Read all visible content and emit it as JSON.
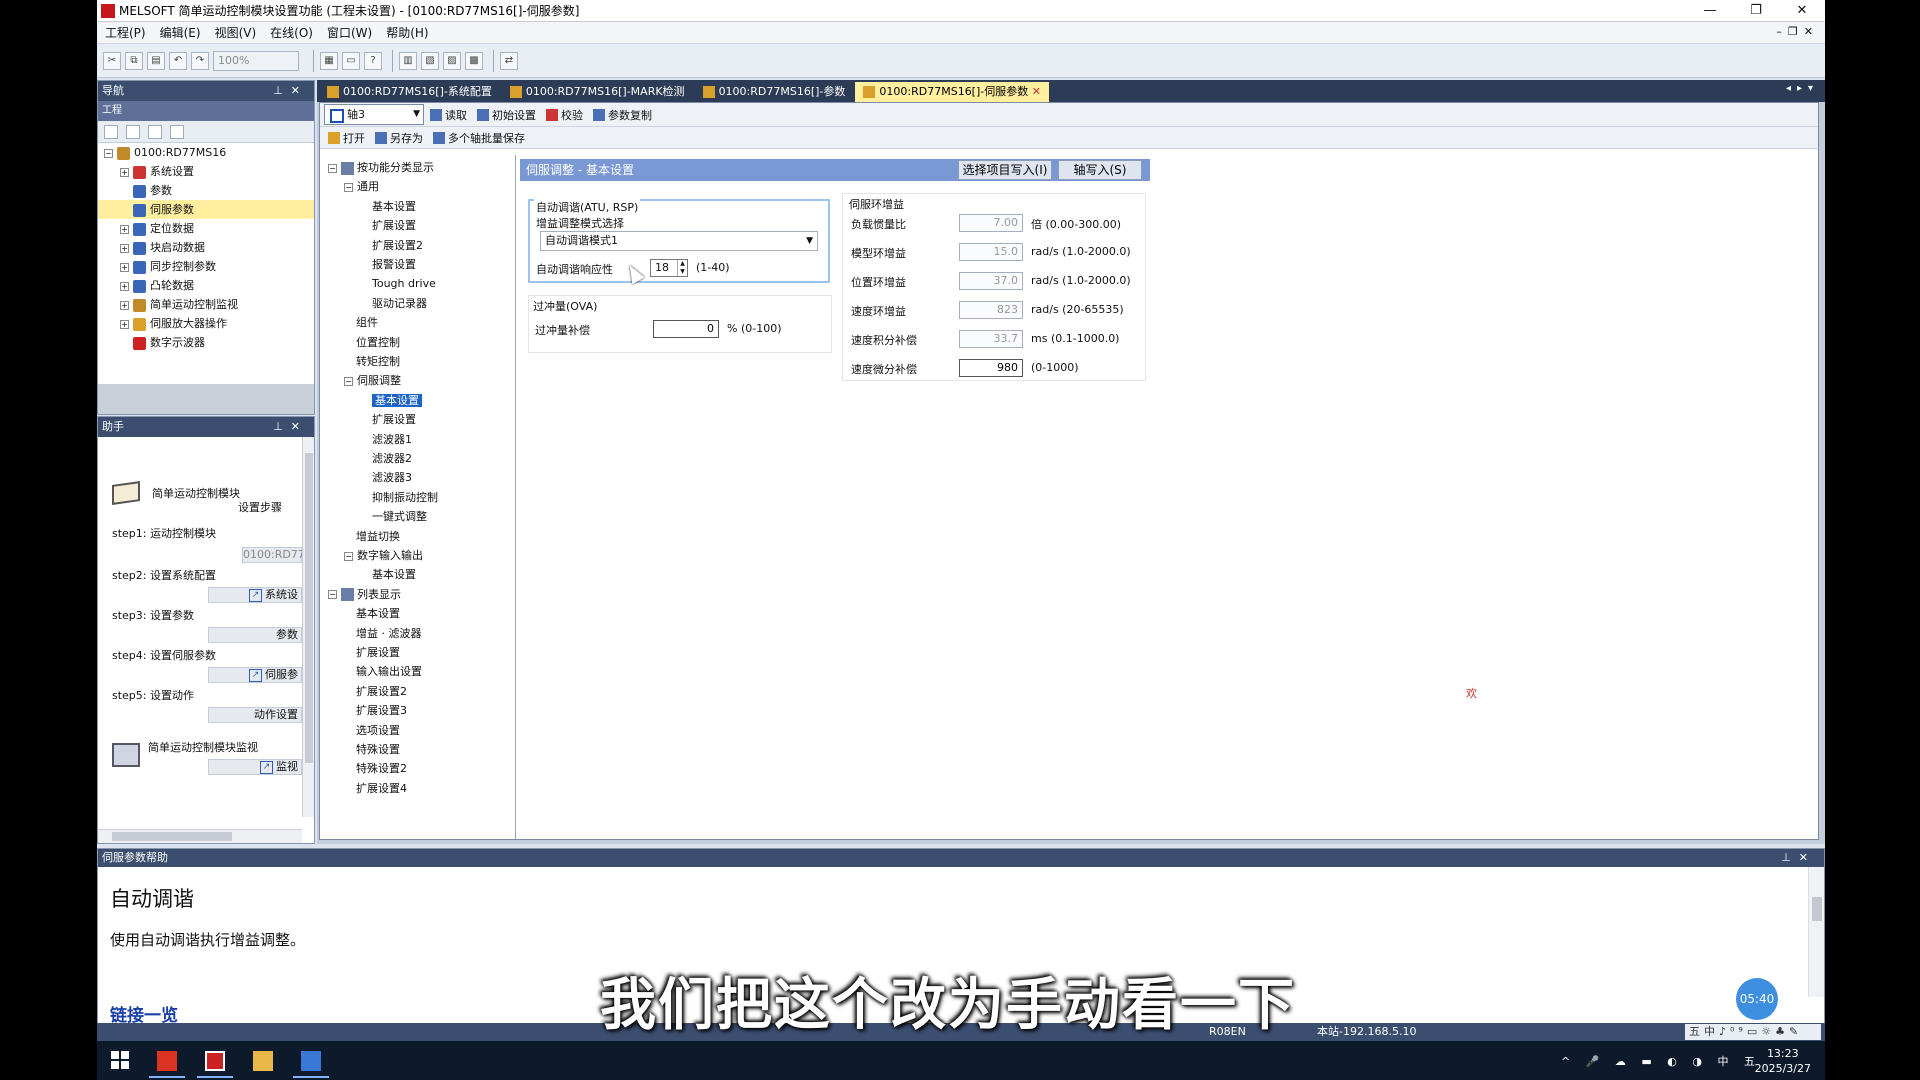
{
  "window": {
    "title": "MELSOFT 简单运动控制模块设置功能 (工程未设置) - [0100:RD77MS16[]-伺服参数]",
    "controls": [
      "—",
      "❐",
      "✕"
    ]
  },
  "menu": {
    "items": [
      "工程(P)",
      "编辑(E)",
      "视图(V)",
      "在线(O)",
      "窗口(W)",
      "帮助(H)"
    ],
    "zoom": "100%"
  },
  "navigation": {
    "header": "导航",
    "subheader": "工程",
    "tree": [
      {
        "label": "0100:RD77MS16",
        "level": 0,
        "exp": "−"
      },
      {
        "label": "系统设置",
        "level": 1,
        "exp": "+"
      },
      {
        "label": "参数",
        "level": 1,
        "exp": ""
      },
      {
        "label": "伺服参数",
        "level": 1,
        "exp": "",
        "selected": true
      },
      {
        "label": "定位数据",
        "level": 1,
        "exp": "+"
      },
      {
        "label": "块启动数据",
        "level": 1,
        "exp": "+"
      },
      {
        "label": "同步控制参数",
        "level": 1,
        "exp": "+"
      },
      {
        "label": "凸轮数据",
        "level": 1,
        "exp": "+"
      },
      {
        "label": "简单运动控制监视",
        "level": 1,
        "exp": "+"
      },
      {
        "label": "伺服放大器操作",
        "level": 1,
        "exp": "+"
      },
      {
        "label": "数字示波器",
        "level": 1,
        "exp": ""
      }
    ]
  },
  "helper": {
    "header": "助手",
    "title_line1": "简单运动控制模块",
    "title_line2": "设置步骤",
    "steps": [
      {
        "label": "step1: 运动控制模块",
        "button": "0100:RD77"
      },
      {
        "label": "step2: 设置系统配置",
        "button": "系统设"
      },
      {
        "label": "step3: 设置参数",
        "button": "参数"
      },
      {
        "label": "step4: 设置伺服参数",
        "button": "伺服参"
      },
      {
        "label": "step5: 设置动作",
        "button": "动作设置"
      }
    ],
    "monitor_label": "简单运动控制模块监视",
    "monitor_button": "监视"
  },
  "tabs": [
    {
      "label": "0100:RD77MS16[]-系统配置",
      "active": false
    },
    {
      "label": "0100:RD77MS16[]-MARK检测",
      "active": false
    },
    {
      "label": "0100:RD77MS16[]-参数",
      "active": false
    },
    {
      "label": "0100:RD77MS16[]-伺服参数",
      "active": true
    }
  ],
  "doctoolbar": {
    "axis": "轴3",
    "read": "读取",
    "init": "初始设置",
    "verify": "校验",
    "copy": "参数复制",
    "open": "打开",
    "saveas": "另存为",
    "batch": "多个轴批量保存"
  },
  "functree": {
    "root1": "按功能分类显示",
    "general": "通用",
    "general_items": [
      "基本设置",
      "扩展设置",
      "扩展设置2",
      "报警设置",
      "Tough drive",
      "驱动记录器"
    ],
    "level1_a": [
      "组件",
      "位置控制",
      "转矩控制"
    ],
    "servo_adj": "伺服调整",
    "servo_items": [
      "基本设置",
      "扩展设置",
      "滤波器1",
      "滤波器2",
      "滤波器3",
      "抑制振动控制",
      "一键式调整"
    ],
    "gain_switch": "增益切换",
    "dio": "数字输入输出",
    "dio_items": [
      "基本设置"
    ],
    "root2": "列表显示",
    "list_items": [
      "基本设置",
      "增益 · 滤波器",
      "扩展设置",
      "输入输出设置",
      "扩展设置2",
      "扩展设置3",
      "选项设置",
      "特殊设置",
      "特殊设置2",
      "扩展设置4"
    ]
  },
  "content": {
    "section_title": "伺服调整 - 基本设置",
    "btn_write_selected": "选择项目写入(I)",
    "btn_axis_write": "轴写入(S)",
    "atu": {
      "group": "自动调谐(ATU, RSP)",
      "mode_label": "增益调整模式选择",
      "mode_value": "自动调谐模式1",
      "resp_label": "自动调谐响应性",
      "resp_value": "18",
      "resp_range": "(1-40)"
    },
    "ova": {
      "group": "过冲量(OVA)",
      "label": "过冲量补偿",
      "value": "0",
      "range": "% (0-100)"
    },
    "loop": {
      "group": "伺服环增益",
      "rows": [
        {
          "label": "负载惯量比",
          "value": "7.00",
          "range": "倍 (0.00-300.00)",
          "ro": true
        },
        {
          "label": "模型环增益",
          "value": "15.0",
          "range": "rad/s (1.0-2000.0)",
          "ro": true
        },
        {
          "label": "位置环增益",
          "value": "37.0",
          "range": "rad/s (1.0-2000.0)",
          "ro": true
        },
        {
          "label": "速度环增益",
          "value": "823",
          "range": "rad/s (20-65535)",
          "ro": true
        },
        {
          "label": "速度积分补偿",
          "value": "33.7",
          "range": "ms (0.1-1000.0)",
          "ro": true
        },
        {
          "label": "速度微分补偿",
          "value": "980",
          "range": "(0-1000)",
          "ro": false
        }
      ]
    },
    "stray_char": "欢"
  },
  "help_panel": {
    "header": "伺服参数帮助",
    "title": "自动调谐",
    "text": "使用自动调谐执行增益调整。",
    "link": "链接一览"
  },
  "subtitle": "我们把这个改为手动看一下",
  "timer": "05:40",
  "statusbar": {
    "cpu": "R08EN",
    "station": "本站-192.168.5.10",
    "ime": "五中♪⁰⁹▭☼♣✎"
  },
  "taskbar": {
    "tray": "^ 🎤 ☁ ▬ ◐ ◑ 中 五",
    "time": "13:23",
    "date": "2025/3/27"
  }
}
